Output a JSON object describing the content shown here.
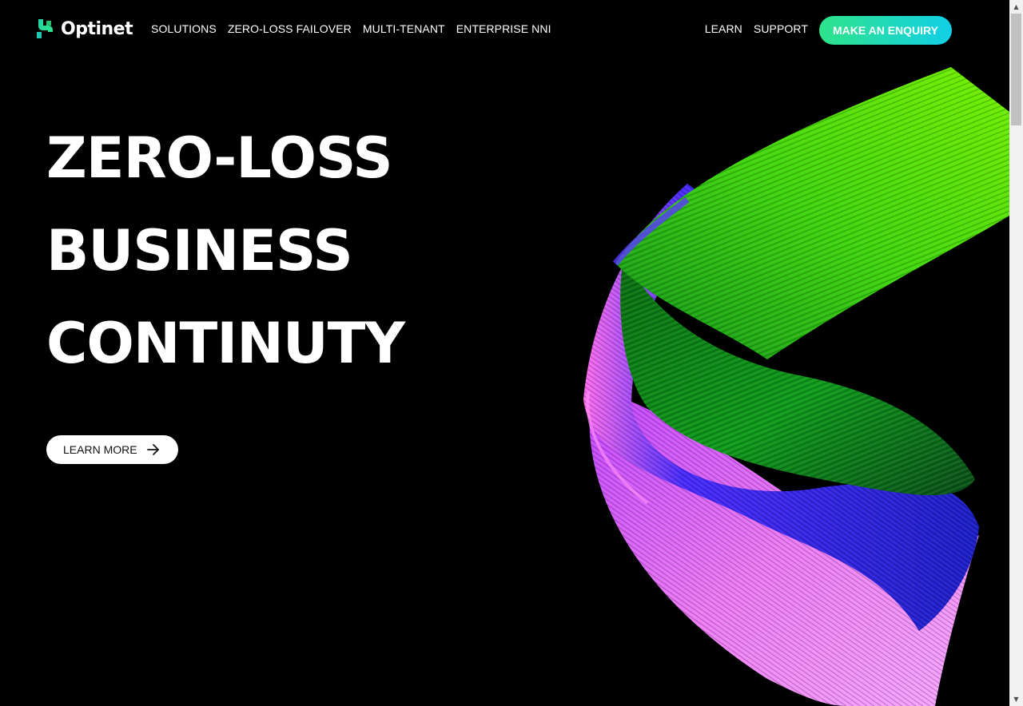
{
  "brand": {
    "name": "Optinet",
    "logo_icon": "optinet-logo-mark",
    "accent_green": "#2fe38a",
    "accent_cyan": "#12cfe6"
  },
  "nav": {
    "primary": [
      {
        "label": "SOLUTIONS"
      },
      {
        "label": "ZERO-LOSS FAILOVER"
      },
      {
        "label": "MULTI-TENANT"
      },
      {
        "label": "ENTERPRISE NNI"
      }
    ],
    "secondary": [
      {
        "label": "LEARN"
      },
      {
        "label": "SUPPORT"
      }
    ],
    "cta_label": "MAKE AN ENQUIRY"
  },
  "hero": {
    "title_lines": [
      "ZERO-LOSS",
      "BUSINESS",
      "CONTINUTY"
    ],
    "button_label": "LEARN MORE",
    "button_icon": "arrow-right-icon",
    "artwork": "green-blue-pink-fiber-ribbon"
  }
}
